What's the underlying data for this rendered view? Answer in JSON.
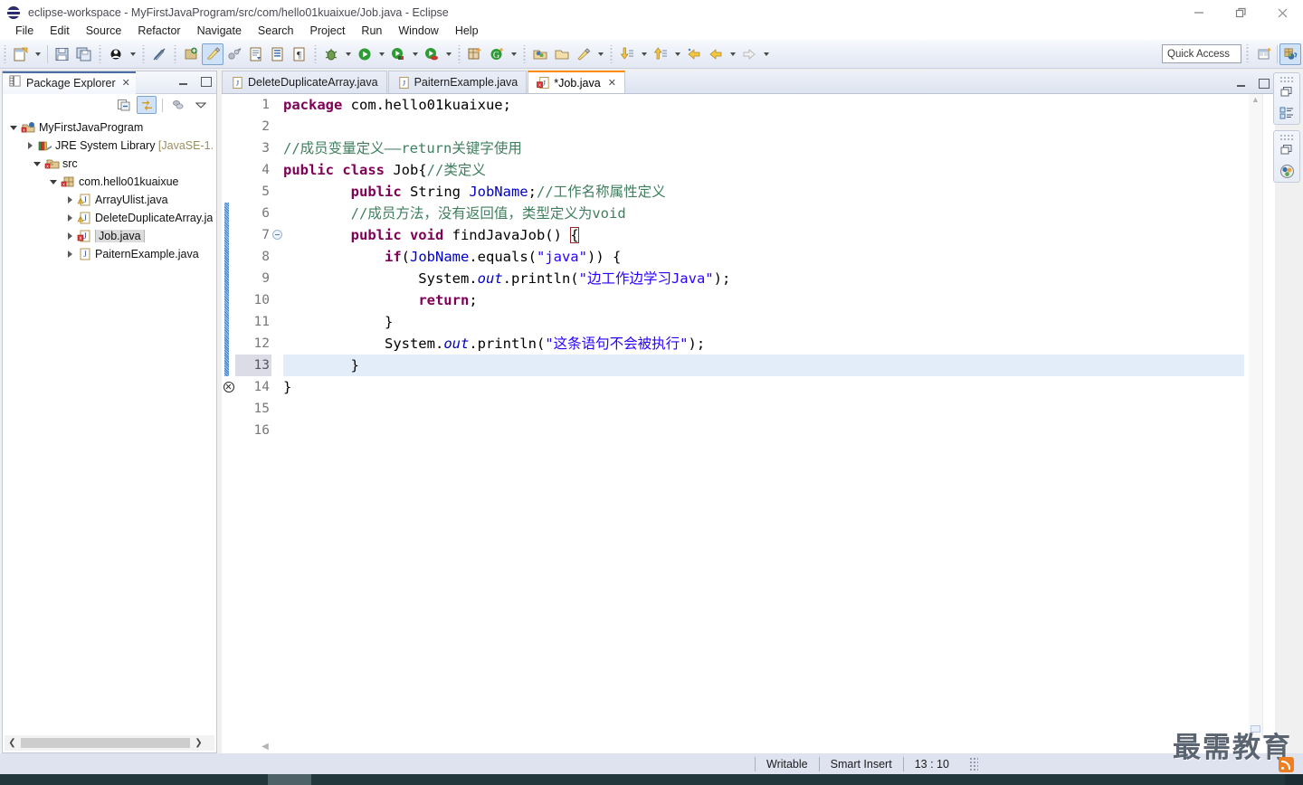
{
  "window": {
    "title": "eclipse-workspace - MyFirstJavaProgram/src/com/hello01kuaixue/Job.java - Eclipse",
    "icon": "eclipse-globe-icon",
    "minimize_label": "—",
    "maximize_label": "❐",
    "close_label": "✕"
  },
  "menubar": {
    "items": [
      {
        "label": "File"
      },
      {
        "label": "Edit"
      },
      {
        "label": "Source"
      },
      {
        "label": "Refactor"
      },
      {
        "label": "Navigate"
      },
      {
        "label": "Search"
      },
      {
        "label": "Project"
      },
      {
        "label": "Run"
      },
      {
        "label": "Window"
      },
      {
        "label": "Help"
      }
    ]
  },
  "toolbar": {
    "quick_access_placeholder": "Quick Access",
    "groups": [
      {
        "items": [
          {
            "name": "new-wizard-icon",
            "arrow": true
          },
          {
            "name": "save-icon",
            "arrow": false
          },
          {
            "name": "save-all-icon",
            "arrow": false
          }
        ]
      },
      {
        "items": [
          {
            "name": "skip-breakpoints-icon",
            "arrow": true
          }
        ]
      },
      {
        "items": [
          {
            "name": "toggle-mark-occurrences-icon",
            "arrow": false
          }
        ]
      },
      {
        "items": [
          {
            "name": "new-java-project-icon",
            "arrow": false
          },
          {
            "name": "highlight-pen-icon",
            "arrow": false
          },
          {
            "name": "link-icon",
            "arrow": false
          },
          {
            "name": "open-type-icon",
            "arrow": false
          },
          {
            "name": "open-task-icon",
            "arrow": false
          },
          {
            "name": "show-whitespace-icon",
            "arrow": false
          }
        ]
      },
      {
        "items": [
          {
            "name": "debug-icon",
            "arrow": true
          },
          {
            "name": "run-icon",
            "arrow": true
          },
          {
            "name": "run-external-tools-icon",
            "arrow": true
          },
          {
            "name": "coverage-icon",
            "arrow": true
          }
        ]
      },
      {
        "items": [
          {
            "name": "new-java-class-icon",
            "arrow": false
          },
          {
            "name": "new-annotation-icon",
            "arrow": true
          }
        ]
      },
      {
        "items": [
          {
            "name": "open-package-icon",
            "arrow": false
          },
          {
            "name": "open-folder-icon",
            "arrow": false
          },
          {
            "name": "search-pen-icon",
            "arrow": true
          }
        ]
      },
      {
        "items": [
          {
            "name": "next-annotation-icon",
            "arrow": true
          },
          {
            "name": "previous-annotation-icon",
            "arrow": true
          },
          {
            "name": "last-edit-location-icon",
            "arrow": false
          },
          {
            "name": "back-icon",
            "arrow": true
          },
          {
            "name": "forward-icon",
            "arrow": true
          }
        ]
      }
    ],
    "right_items": [
      {
        "name": "open-perspective-icon"
      },
      {
        "name": "java-perspective-icon"
      }
    ]
  },
  "package_explorer": {
    "tab_title": "Package Explorer",
    "tab_close": "✕",
    "tab_icon": "package-explorer-icon",
    "tools": [
      {
        "name": "collapse-all-icon",
        "active": false
      },
      {
        "name": "link-with-editor-icon",
        "active": true
      },
      {
        "name": "view-menu-icon",
        "active": false
      },
      {
        "name": "view-dropdown-icon",
        "active": false
      }
    ],
    "tree": [
      {
        "depth": 0,
        "twisty": "down",
        "icon": "java-project-icon",
        "label": "MyFirstJavaProgram",
        "suffix": "",
        "selected": false
      },
      {
        "depth": 1,
        "twisty": "right",
        "icon": "jre-library-icon",
        "label": "JRE System Library",
        "suffix": " [JavaSE-1.",
        "selected": false
      },
      {
        "depth": 1,
        "twisty": "down",
        "icon": "source-folder-icon",
        "label": "src",
        "suffix": "",
        "selected": false
      },
      {
        "depth": 2,
        "twisty": "down",
        "icon": "package-icon",
        "label": "com.hello01kuaixue",
        "suffix": "",
        "selected": false
      },
      {
        "depth": 3,
        "twisty": "right",
        "icon": "java-warning-icon",
        "label": "ArrayUlist.java",
        "suffix": "",
        "selected": false
      },
      {
        "depth": 3,
        "twisty": "right",
        "icon": "java-warning-icon",
        "label": "DeleteDuplicateArray.ja",
        "suffix": "",
        "selected": false
      },
      {
        "depth": 3,
        "twisty": "right",
        "icon": "java-error-icon",
        "label": "Job.java",
        "suffix": "",
        "selected": true
      },
      {
        "depth": 3,
        "twisty": "right",
        "icon": "java-file-icon",
        "label": "PaiternExample.java",
        "suffix": "",
        "selected": false
      }
    ],
    "hscroll": {
      "left_arrow": "❮",
      "right_arrow": "❯"
    }
  },
  "editor": {
    "tabs": [
      {
        "label": "DeleteDuplicateArray.java",
        "icon": "java-file-icon",
        "active": false,
        "dirty": false,
        "close": ""
      },
      {
        "label": "PaiternExample.java",
        "icon": "java-file-icon",
        "active": false,
        "dirty": false,
        "close": ""
      },
      {
        "label": "*Job.java",
        "icon": "java-error-icon",
        "active": true,
        "dirty": true,
        "close": "✕"
      }
    ],
    "minimize_label": "—",
    "maximize_label": "❐",
    "current_line": 13,
    "error_line": 14,
    "change_bar_from": 6,
    "change_bar_to": 13,
    "fold_lines": [
      7
    ],
    "lines": [
      {
        "n": 1,
        "tokens": [
          {
            "t": "package",
            "c": "k"
          },
          {
            "t": " com.hello01kuaixue;",
            "c": ""
          }
        ]
      },
      {
        "n": 2,
        "tokens": [
          {
            "t": "",
            "c": ""
          }
        ]
      },
      {
        "n": 3,
        "tokens": [
          {
            "t": "//成员变量定义——return关键字使用",
            "c": "c"
          }
        ]
      },
      {
        "n": 4,
        "tokens": [
          {
            "t": "public class",
            "c": "k"
          },
          {
            "t": " Job{",
            "c": ""
          },
          {
            "t": "//类定义",
            "c": "c"
          }
        ]
      },
      {
        "n": 5,
        "tokens": [
          {
            "t": "        ",
            "c": ""
          },
          {
            "t": "public",
            "c": "k"
          },
          {
            "t": " String ",
            "c": ""
          },
          {
            "t": "JobName",
            "c": "f"
          },
          {
            "t": ";",
            "c": ""
          },
          {
            "t": "//工作名称属性定义",
            "c": "c"
          }
        ]
      },
      {
        "n": 6,
        "tokens": [
          {
            "t": "        ",
            "c": ""
          },
          {
            "t": "//成员方法，没有返回值，类型定义为void",
            "c": "c"
          }
        ]
      },
      {
        "n": 7,
        "tokens": [
          {
            "t": "        ",
            "c": ""
          },
          {
            "t": "public void",
            "c": "k"
          },
          {
            "t": " findJavaJob() ",
            "c": ""
          },
          {
            "t": "{",
            "c": "caret-brace"
          }
        ]
      },
      {
        "n": 8,
        "tokens": [
          {
            "t": "            ",
            "c": ""
          },
          {
            "t": "if",
            "c": "k"
          },
          {
            "t": "(",
            "c": ""
          },
          {
            "t": "JobName",
            "c": "f"
          },
          {
            "t": ".equals(",
            "c": ""
          },
          {
            "t": "\"java\"",
            "c": "s"
          },
          {
            "t": ")) {",
            "c": ""
          }
        ]
      },
      {
        "n": 9,
        "tokens": [
          {
            "t": "                ",
            "c": ""
          },
          {
            "t": "System.",
            "c": ""
          },
          {
            "t": "out",
            "c": "sf"
          },
          {
            "t": ".println(",
            "c": ""
          },
          {
            "t": "\"边工作边学习Java\"",
            "c": "s"
          },
          {
            "t": ");",
            "c": ""
          }
        ]
      },
      {
        "n": 10,
        "tokens": [
          {
            "t": "                ",
            "c": ""
          },
          {
            "t": "return",
            "c": "k"
          },
          {
            "t": ";",
            "c": ""
          }
        ]
      },
      {
        "n": 11,
        "tokens": [
          {
            "t": "            }",
            "c": ""
          }
        ]
      },
      {
        "n": 12,
        "tokens": [
          {
            "t": "            ",
            "c": ""
          },
          {
            "t": "System.",
            "c": ""
          },
          {
            "t": "out",
            "c": "sf"
          },
          {
            "t": ".println(",
            "c": ""
          },
          {
            "t": "\"这条语句不会被执行\"",
            "c": "s"
          },
          {
            "t": ");",
            "c": ""
          }
        ]
      },
      {
        "n": 13,
        "tokens": [
          {
            "t": "        }",
            "c": ""
          }
        ]
      },
      {
        "n": 14,
        "tokens": [
          {
            "t": "}",
            "c": ""
          }
        ]
      },
      {
        "n": 15,
        "tokens": [
          {
            "t": "",
            "c": ""
          }
        ]
      },
      {
        "n": 16,
        "tokens": [
          {
            "t": "",
            "c": ""
          }
        ]
      }
    ]
  },
  "right_stacks": [
    {
      "items": [
        {
          "name": "restore-icon"
        },
        {
          "name": "outline-view-icon"
        }
      ]
    },
    {
      "items": [
        {
          "name": "restore-icon"
        },
        {
          "name": "coverage-view-icon"
        }
      ]
    }
  ],
  "statusbar": {
    "writable": "Writable",
    "insert_mode": "Smart Insert",
    "position": "13 : 10"
  },
  "watermark": {
    "text": "最需教育",
    "badge": "rss-icon"
  },
  "colors": {
    "keyword": "#7F0055",
    "string": "#2A00FF",
    "comment": "#3F7F5F",
    "field": "#0000C0",
    "accent_tab": "#FF8C00",
    "status_bg": "#DFE3F0"
  }
}
